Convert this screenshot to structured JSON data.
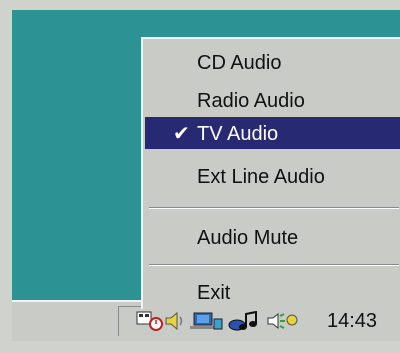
{
  "menu": {
    "items": [
      {
        "label": "CD Audio"
      },
      {
        "label": "Radio Audio"
      },
      {
        "label": "TV Audio",
        "selected": true
      },
      {
        "label": "Ext Line Audio"
      },
      {
        "label": "Audio Mute"
      },
      {
        "label": "Exit"
      }
    ]
  },
  "tray": {
    "icons": [
      "scheduler-icon",
      "speaker-icon",
      "network-icon",
      "music-icon",
      "volume-icon"
    ],
    "clock": "14:43"
  },
  "colors": {
    "desktop": "#2c9293",
    "menu_bg": "#c9cbc6",
    "selected_bg": "#272a72"
  }
}
